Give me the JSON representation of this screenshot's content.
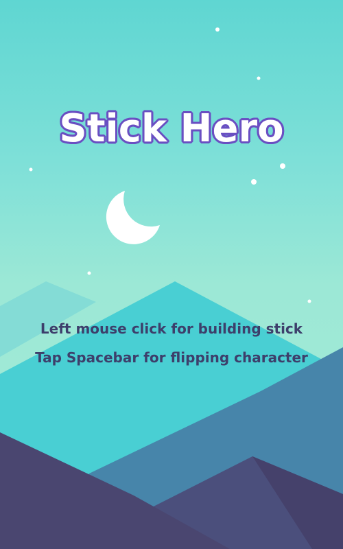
{
  "game": {
    "title": "Stick Hero",
    "instructions": [
      "Left mouse click for building stick",
      "Tap Spacebar for flipping character"
    ]
  },
  "scene": {
    "elements": [
      "moon-icon",
      "star-icon",
      "mountain-shape"
    ]
  },
  "colors": {
    "sky_top": "#5fd6d2",
    "sky_bottom": "#a6ecd6",
    "title_fill": "#ffffff",
    "title_outline": "#6a4fc2",
    "instruction_text": "#3d3f6b",
    "mountain_light": "#84dcd6",
    "mountain_teal": "#49cfd3",
    "mountain_blue": "#4785aa",
    "mountain_dark": "#4a4670"
  }
}
